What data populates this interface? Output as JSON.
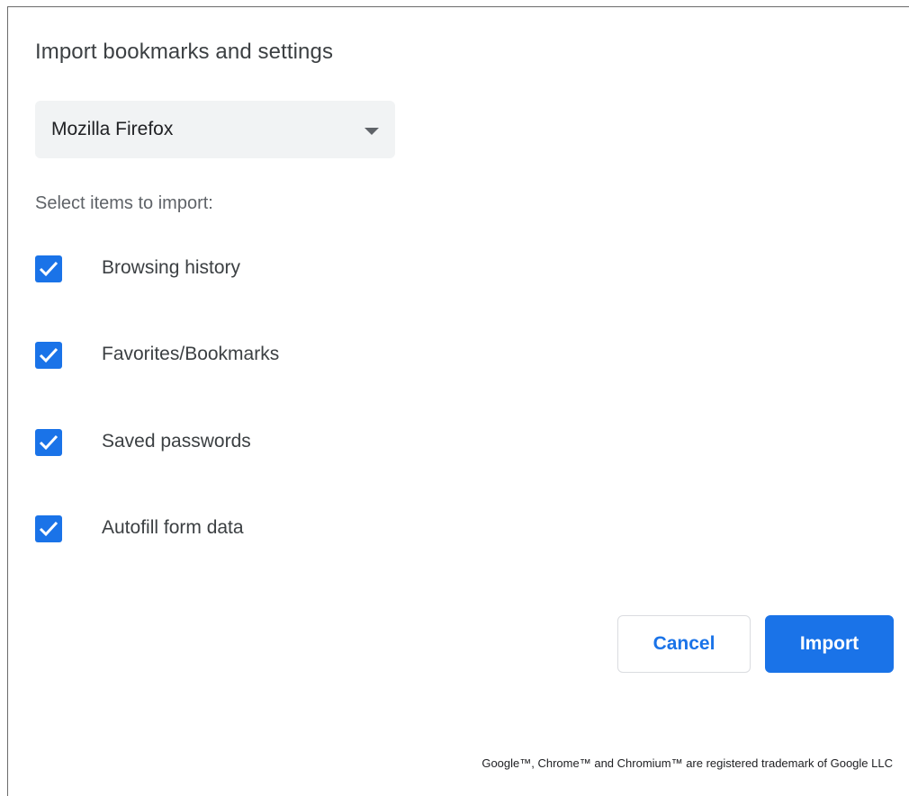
{
  "dialog": {
    "title": "Import bookmarks and settings",
    "browser_select": {
      "selected": "Mozilla Firefox"
    },
    "section_label": "Select items to import:",
    "options": [
      {
        "label": "Browsing history",
        "checked": true
      },
      {
        "label": "Favorites/Bookmarks",
        "checked": true
      },
      {
        "label": "Saved passwords",
        "checked": true
      },
      {
        "label": "Autofill form data",
        "checked": true
      }
    ],
    "buttons": {
      "cancel": "Cancel",
      "import": "Import"
    },
    "footer": "Google™, Chrome™ and Chromium™ are registered trademark of Google LLC"
  },
  "colors": {
    "accent": "#1a73e8",
    "select_background": "#f1f3f4",
    "secondary_text": "#5f6368"
  }
}
